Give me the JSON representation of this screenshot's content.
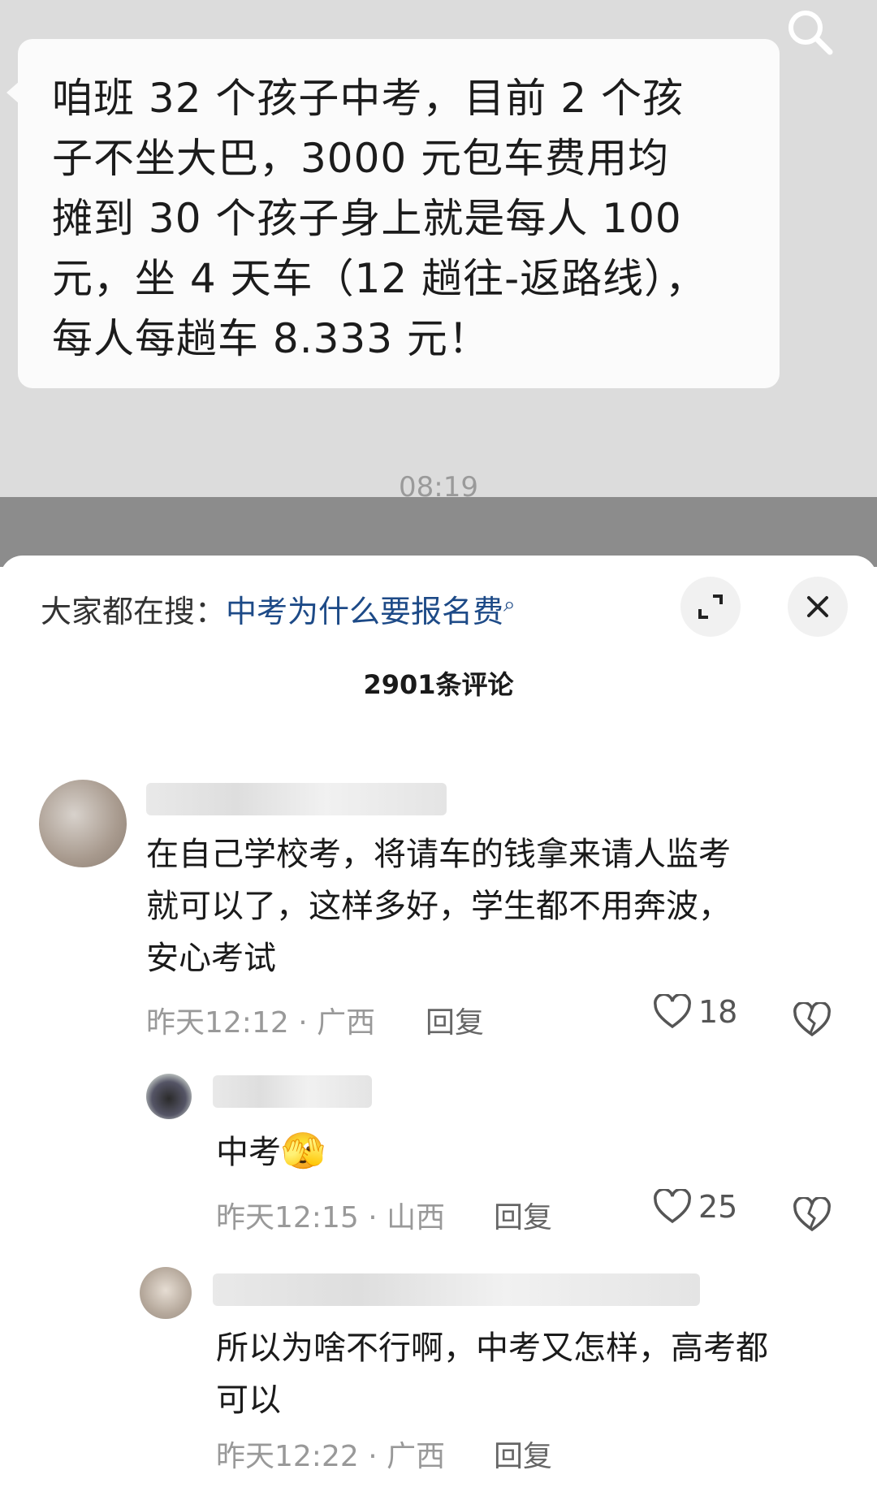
{
  "chat": {
    "message": "咱班 32 个孩子中考，目前 2 个孩\n子不坐大巴，3000 元包车费用均\n摊到 30 个孩子身上就是每人 100\n元，坐 4 天车（12 趟往-返路线），\n每人每趟车 8.333 元！",
    "time": "08:19",
    "icons": {
      "search": "search-icon"
    }
  },
  "sheet": {
    "search_prefix": "大家都在搜：",
    "search_link": "中考为什么要报名费",
    "search_link_icon": "⌕",
    "comment_count": "2901条评论",
    "icons": {
      "expand": "expand-icon",
      "close": "close-icon"
    }
  },
  "comments": [
    {
      "text": "在自己学校考，将请车的钱拿来请人监考\n就可以了，这样多好，学生都不用奔波，\n安心考试",
      "meta": "昨天12:12 · 广西",
      "reply_label": "回复",
      "likes": "18"
    },
    {
      "text": "中考",
      "emoji": "🫣",
      "meta": "昨天12:15 · 山西",
      "reply_label": "回复",
      "likes": "25"
    },
    {
      "text": "所以为啥不行啊，中考又怎样，高考都\n可以",
      "meta": "昨天12:22 · 广西",
      "reply_label": "回复"
    }
  ],
  "colors": {
    "accent_link": "#1d4a87",
    "chat_bg": "#dcdcdc",
    "meta_gray": "#999999"
  }
}
